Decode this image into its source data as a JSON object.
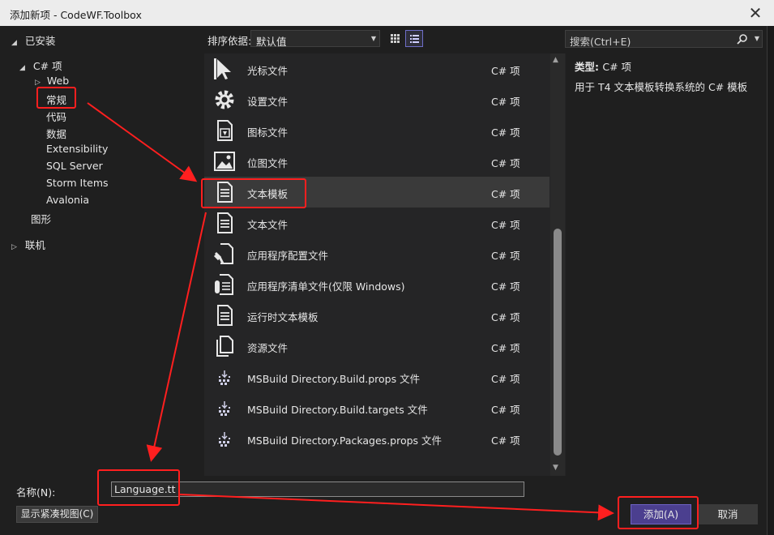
{
  "window": {
    "title": "添加新项 - CodeWF.Toolbox",
    "close_glyph": "✕"
  },
  "tree": {
    "installed": "已安装",
    "csharp": "C# 项",
    "web": "Web",
    "general": "常规",
    "code": "代码",
    "data": "数据",
    "extensibility": "Extensibility",
    "sql": "SQL Server",
    "storm": "Storm Items",
    "avalonia": "Avalonia",
    "graphics": "图形",
    "online": "联机"
  },
  "toolbar": {
    "sort_label": "排序依据:",
    "sort_value": "默认值"
  },
  "search": {
    "placeholder": "搜索(Ctrl+E)"
  },
  "templates": [
    {
      "name": "光标文件",
      "lang": "C# 项",
      "icon": "cursor-file-icon"
    },
    {
      "name": "设置文件",
      "lang": "C# 项",
      "icon": "settings-file-icon"
    },
    {
      "name": "图标文件",
      "lang": "C# 项",
      "icon": "icon-file-icon"
    },
    {
      "name": "位图文件",
      "lang": "C# 项",
      "icon": "bitmap-file-icon"
    },
    {
      "name": "文本模板",
      "lang": "C# 项",
      "icon": "text-template-icon",
      "selected": true
    },
    {
      "name": "文本文件",
      "lang": "C# 项",
      "icon": "text-file-icon"
    },
    {
      "name": "应用程序配置文件",
      "lang": "C# 项",
      "icon": "app-config-icon"
    },
    {
      "name": "应用程序清单文件(仅限 Windows)",
      "lang": "C# 项",
      "icon": "app-manifest-icon"
    },
    {
      "name": "运行时文本模板",
      "lang": "C# 项",
      "icon": "runtime-template-icon"
    },
    {
      "name": "资源文件",
      "lang": "C# 项",
      "icon": "resource-file-icon"
    },
    {
      "name": "MSBuild Directory.Build.props 文件",
      "lang": "C# 项",
      "icon": "msbuild-icon"
    },
    {
      "name": "MSBuild Directory.Build.targets 文件",
      "lang": "C# 项",
      "icon": "msbuild-icon"
    },
    {
      "name": "MSBuild Directory.Packages.props 文件",
      "lang": "C# 项",
      "icon": "msbuild-icon"
    }
  ],
  "detail": {
    "type_label": "类型:",
    "type_value": "C# 项",
    "description": "用于 T4 文本模板转换系统的 C# 模板"
  },
  "bottom": {
    "name_label": "名称(N):",
    "name_value": "Language.tt",
    "compact_view": "显示紧凑视图(C)",
    "add": "添加(A)",
    "cancel": "取消"
  },
  "colors": {
    "annotation": "#ff1f1f",
    "accent": "#4b3f8f"
  }
}
